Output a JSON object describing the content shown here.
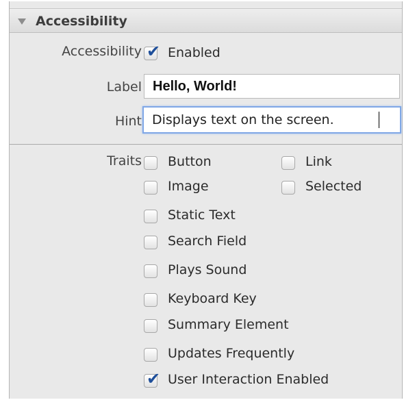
{
  "section": {
    "title": "Accessibility",
    "collapse_icon": "triangle-down-icon"
  },
  "accessibility": {
    "label": "Accessibility",
    "checkbox_label": "Enabled",
    "checked": true
  },
  "label_field": {
    "label": "Label",
    "value": "Hello, World!"
  },
  "hint_field": {
    "label": "Hint",
    "value": "Displays text on the screen."
  },
  "traits": {
    "label": "Traits",
    "items": [
      {
        "label": "Button",
        "checked": false
      },
      {
        "label": "Link",
        "checked": false
      },
      {
        "label": "Image",
        "checked": false
      },
      {
        "label": "Selected",
        "checked": false
      },
      {
        "label": "Static Text",
        "checked": false
      },
      {
        "label": "Search Field",
        "checked": false
      },
      {
        "label": "Plays Sound",
        "checked": false
      },
      {
        "label": "Keyboard Key",
        "checked": false
      },
      {
        "label": "Summary Element",
        "checked": false
      },
      {
        "label": "Updates Frequently",
        "checked": false
      },
      {
        "label": "User Interaction Enabled",
        "checked": true
      }
    ]
  },
  "colors": {
    "panel_bg": "#e9e9e9",
    "check_color": "#1f4f9a",
    "focus_ring": "#7fa7e6"
  }
}
